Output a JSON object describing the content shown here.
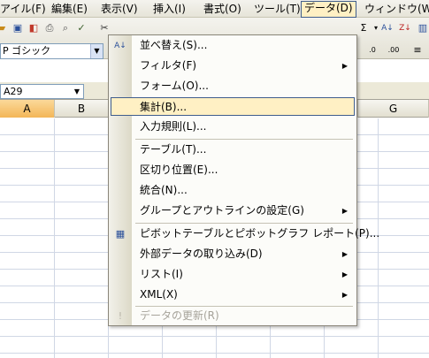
{
  "menubar": {
    "items": [
      {
        "label": "アイル(F)"
      },
      {
        "label": "編集(E)"
      },
      {
        "label": "表示(V)"
      },
      {
        "label": "挿入(I)"
      },
      {
        "label": "書式(O)"
      },
      {
        "label": "ツール(T)"
      },
      {
        "label": "データ(D)"
      },
      {
        "label": "ウィンドウ(W)"
      }
    ]
  },
  "toolbar": {
    "font_name": "P ゴシック"
  },
  "name_box": {
    "value": "A29"
  },
  "columns": [
    "A",
    "B",
    "G"
  ],
  "data_menu": {
    "items": [
      {
        "label": "並べ替え(S)..."
      },
      {
        "label": "フィルタ(F)"
      },
      {
        "label": "フォーム(O)..."
      },
      {
        "label": "集計(B)..."
      },
      {
        "label": "入力規則(L)..."
      },
      {
        "label": "テーブル(T)..."
      },
      {
        "label": "区切り位置(E)..."
      },
      {
        "label": "統合(N)..."
      },
      {
        "label": "グループとアウトラインの設定(G)"
      },
      {
        "label": "ピボットテーブルとピボットグラフ レポート(P)..."
      },
      {
        "label": "外部データの取り込み(D)"
      },
      {
        "label": "リスト(I)"
      },
      {
        "label": "XML(X)"
      },
      {
        "label": "データの更新(R)"
      }
    ]
  }
}
